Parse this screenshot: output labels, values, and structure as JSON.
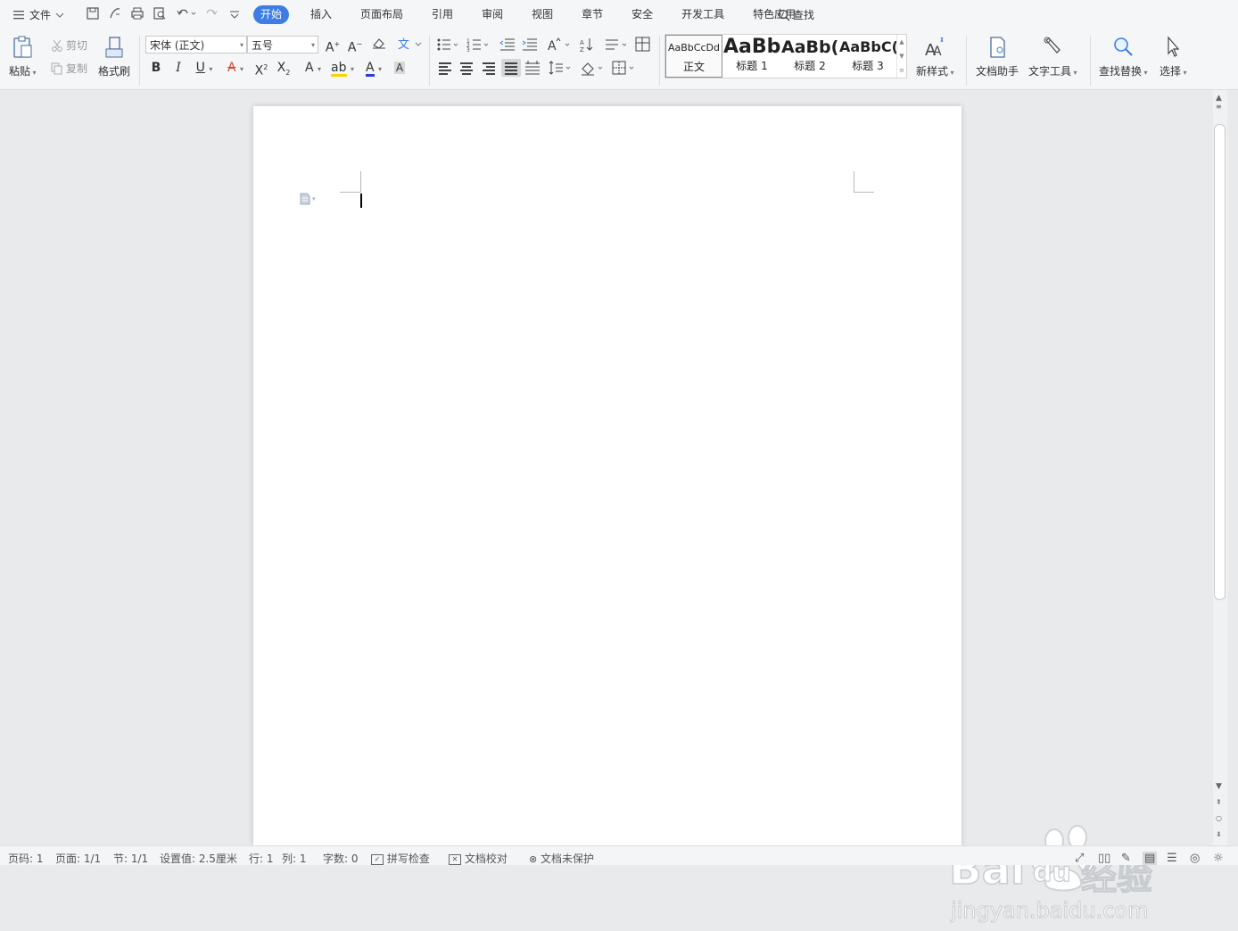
{
  "menu": {
    "file_label": "文件"
  },
  "tabs": [
    "开始",
    "插入",
    "页面布局",
    "引用",
    "审阅",
    "视图",
    "章节",
    "安全",
    "开发工具",
    "特色应用"
  ],
  "search_tab": "查找",
  "clipboard": {
    "paste": "粘贴",
    "cut": "剪切",
    "copy": "复制",
    "format_painter": "格式刷"
  },
  "font": {
    "name": "宋体 (正文)",
    "size": "五号"
  },
  "styles": [
    {
      "preview": "AaBbCcDd",
      "name": "正文"
    },
    {
      "preview": "AaBb",
      "name": "标题 1"
    },
    {
      "preview": "AaBb(",
      "name": "标题 2"
    },
    {
      "preview": "AaBbC(",
      "name": "标题 3"
    }
  ],
  "ribbon_buttons": {
    "new_style": "新样式",
    "doc_assistant": "文档助手",
    "text_tools": "文字工具",
    "find_replace": "查找替换",
    "select": "选择"
  },
  "status": {
    "page_code": "页码: 1",
    "pages": "页面: 1/1",
    "section": "节: 1/1",
    "set_value": "设置值: 2.5厘米",
    "row": "行: 1",
    "col": "列: 1",
    "word_count": "字数: 0",
    "spell_check": "拼写检查",
    "proofread": "文档校对",
    "protection": "文档未保护"
  },
  "watermark": {
    "brand": "Bai",
    "brand_suffix": "du",
    "cn": "经验",
    "url": "jingyan.baidu.com"
  },
  "colors": {
    "accent": "#3c7ee6",
    "highlight": "#f5d400",
    "font_color": "#2b3ad8"
  }
}
